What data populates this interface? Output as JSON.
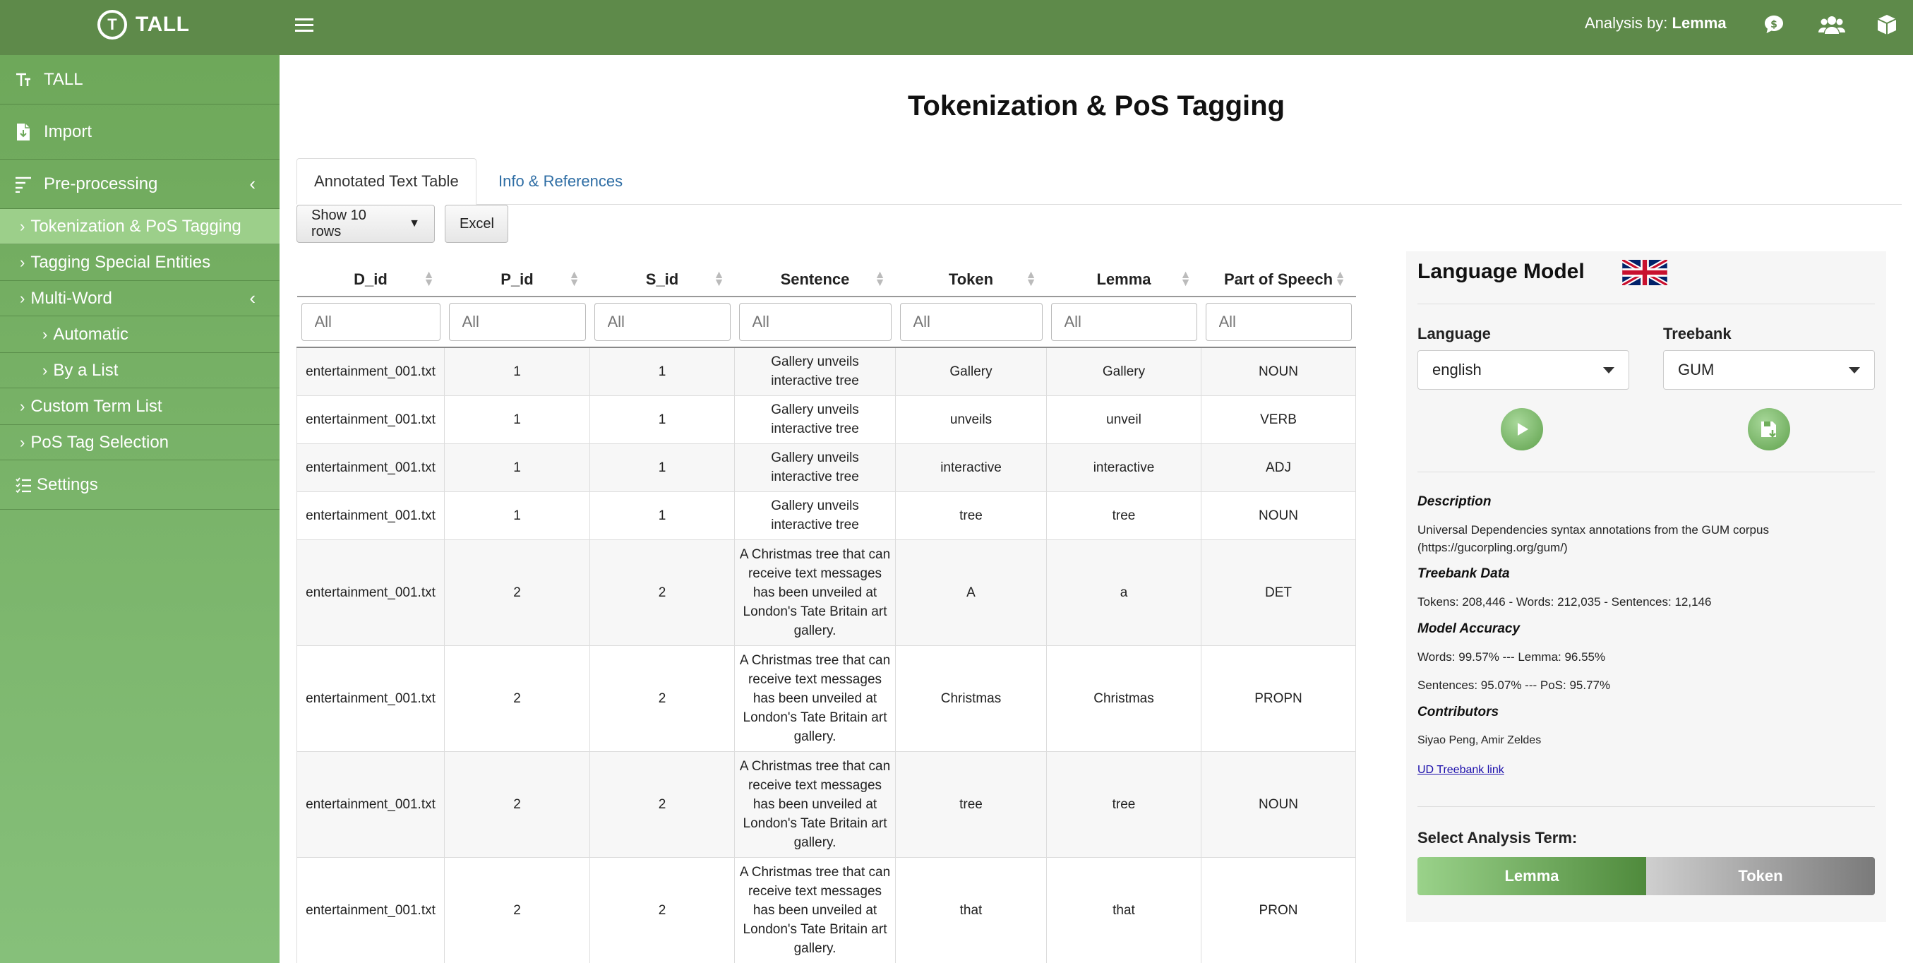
{
  "header": {
    "logo_letter": "T",
    "app_name": "TALL",
    "analysis_prefix": "Analysis by:",
    "analysis_value": "Lemma"
  },
  "sidebar": {
    "items": [
      {
        "label": "TALL",
        "icon": "text-icon"
      },
      {
        "label": "Import",
        "icon": "file-icon"
      },
      {
        "label": "Pre-processing",
        "icon": "filter-icon"
      },
      {
        "label": "Tokenization & PoS Tagging"
      },
      {
        "label": "Tagging Special Entities"
      },
      {
        "label": "Multi-Word"
      },
      {
        "label": "Automatic"
      },
      {
        "label": "By a List"
      },
      {
        "label": "Custom Term List"
      },
      {
        "label": "PoS Tag Selection"
      },
      {
        "label": "Settings",
        "icon": "list-icon"
      }
    ]
  },
  "main": {
    "title": "Tokenization & PoS Tagging",
    "tabs": [
      {
        "label": "Annotated Text Table"
      },
      {
        "label": "Info & References"
      }
    ],
    "show_rows_label": "Show 10 rows",
    "excel_label": "Excel"
  },
  "table": {
    "columns": [
      "D_id",
      "P_id",
      "S_id",
      "Sentence",
      "Token",
      "Lemma",
      "Part of Speech"
    ],
    "filter_placeholder": "All",
    "rows": [
      [
        "entertainment_001.txt",
        "1",
        "1",
        "Gallery unveils interactive tree",
        "Gallery",
        "Gallery",
        "NOUN"
      ],
      [
        "entertainment_001.txt",
        "1",
        "1",
        "Gallery unveils interactive tree",
        "unveils",
        "unveil",
        "VERB"
      ],
      [
        "entertainment_001.txt",
        "1",
        "1",
        "Gallery unveils interactive tree",
        "interactive",
        "interactive",
        "ADJ"
      ],
      [
        "entertainment_001.txt",
        "1",
        "1",
        "Gallery unveils interactive tree",
        "tree",
        "tree",
        "NOUN"
      ],
      [
        "entertainment_001.txt",
        "2",
        "2",
        "A Christmas tree that can receive text messages has been unveiled at London's Tate Britain art gallery.",
        "A",
        "a",
        "DET"
      ],
      [
        "entertainment_001.txt",
        "2",
        "2",
        "A Christmas tree that can receive text messages has been unveiled at London's Tate Britain art gallery.",
        "Christmas",
        "Christmas",
        "PROPN"
      ],
      [
        "entertainment_001.txt",
        "2",
        "2",
        "A Christmas tree that can receive text messages has been unveiled at London's Tate Britain art gallery.",
        "tree",
        "tree",
        "NOUN"
      ],
      [
        "entertainment_001.txt",
        "2",
        "2",
        "A Christmas tree that can receive text messages has been unveiled at London's Tate Britain art gallery.",
        "that",
        "that",
        "PRON"
      ]
    ]
  },
  "panel": {
    "title": "Language Model",
    "language_label": "Language",
    "language_value": "english",
    "treebank_label": "Treebank",
    "treebank_value": "GUM",
    "description_h": "Description",
    "description_t": "Universal Dependencies syntax annotations from the GUM corpus (https://gucorpling.org/gum/)",
    "treebank_h": "Treebank Data",
    "treebank_t": "Tokens: 208,446 - Words: 212,035 - Sentences: 12,146",
    "accuracy_h": "Model Accuracy",
    "accuracy_t1": "Words: 99.57% --- Lemma: 96.55%",
    "accuracy_t2": "Sentences: 95.07% --- PoS: 95.77%",
    "contributors_h": "Contributors",
    "contributors_t": "Siyao Peng, Amir Zeldes",
    "link": "UD Treebank link",
    "select_term_h": "Select Analysis Term:",
    "seg_lemma": "Lemma",
    "seg_token": "Token"
  }
}
